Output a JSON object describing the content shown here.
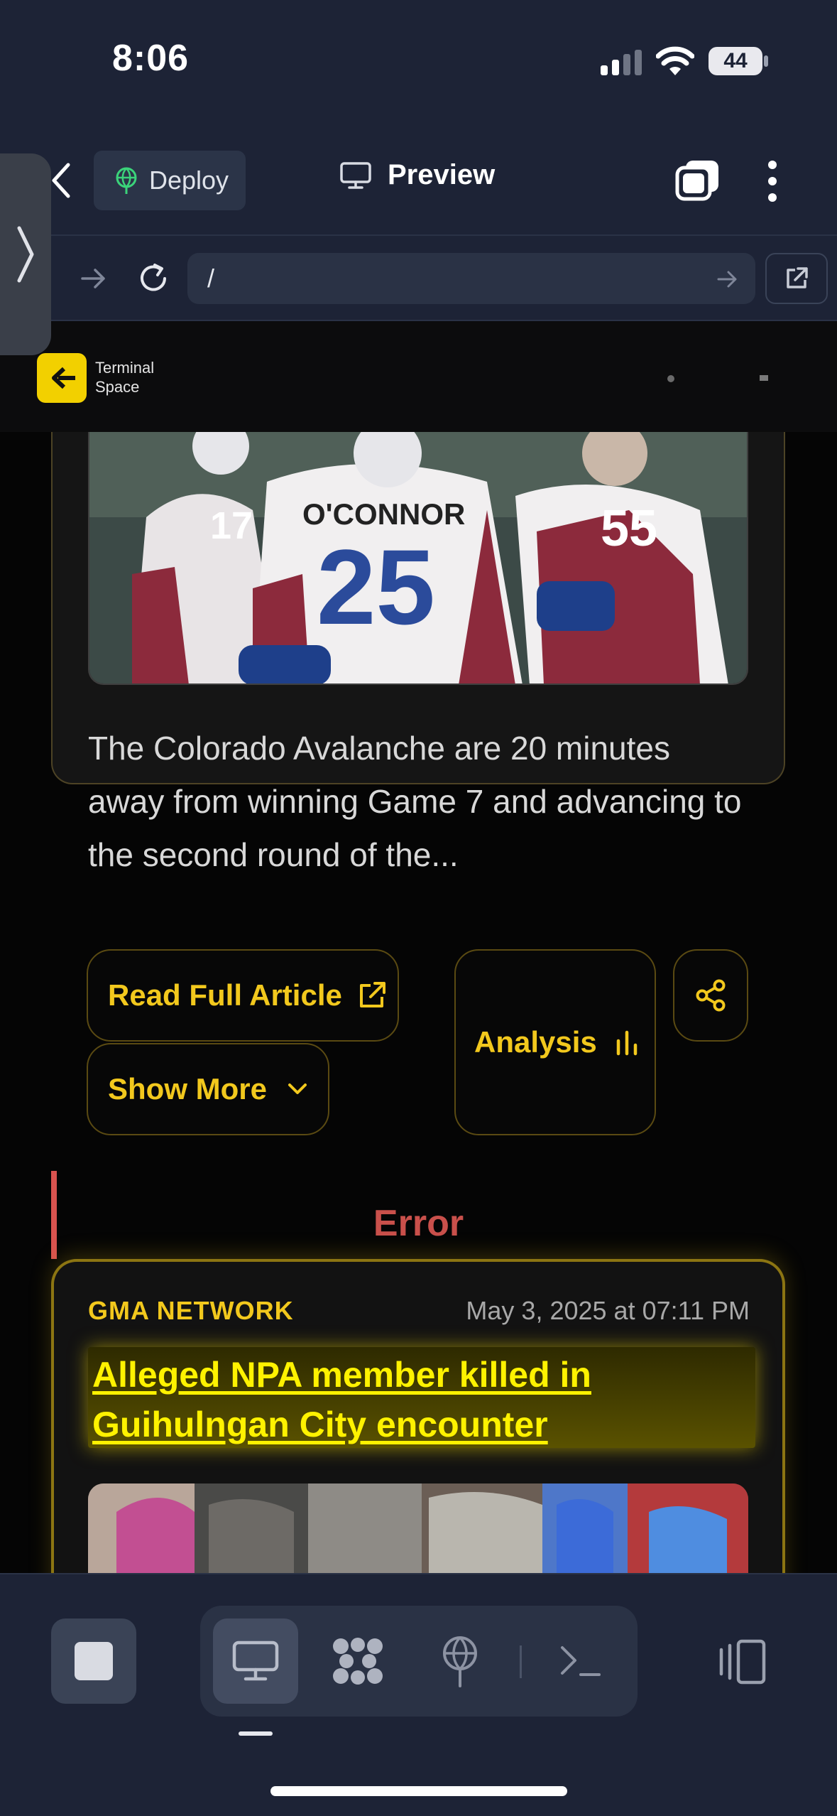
{
  "status_bar": {
    "time": "8:06",
    "battery": "44"
  },
  "toolbar": {
    "deploy_label": "Deploy",
    "preview_label": "Preview"
  },
  "url_bar": {
    "value": "/"
  },
  "site": {
    "logo_text_line1": "Terminal",
    "logo_text_line2": "Space"
  },
  "article1": {
    "summary": "The Colorado Avalanche are 20 minutes away from winning Game 7 and advancing to the second round of the...",
    "read_full_label": "Read Full Article",
    "show_more_label": "Show More",
    "analysis_label": "Analysis",
    "jersey_numbers": [
      "17",
      "25",
      "55"
    ],
    "jersey_name": "O'CONNOR"
  },
  "error": {
    "label": "Error"
  },
  "article2": {
    "source": "GMA NETWORK",
    "date": "May 3, 2025 at 07:11 PM",
    "headline": "Alleged NPA member killed in Guihulngan City encounter"
  },
  "colors": {
    "accent": "#f2c81d",
    "error": "#c9504b",
    "background": "#1d2336",
    "headline": "#fff200"
  }
}
